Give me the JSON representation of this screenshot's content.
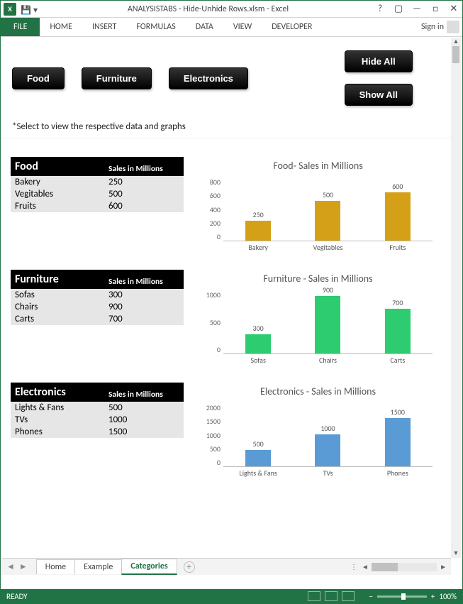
{
  "titlebar": {
    "app_short": "X",
    "title": "ANALYSISTABS - Hide-Unhide Rows.xlsm - Excel"
  },
  "win": {
    "help": "?",
    "ribbonopt": "▢",
    "min": "—",
    "max": "□",
    "close": "✕"
  },
  "ribbon": {
    "file": "FILE",
    "tabs": [
      "HOME",
      "INSERT",
      "FORMULAS",
      "DATA",
      "VIEW",
      "DEVELOPER"
    ],
    "signin": "Sign in"
  },
  "top": {
    "btn_food": "Food",
    "btn_furniture": "Furniture",
    "btn_electronics": "Electronics",
    "btn_hide": "Hide All",
    "btn_show": "Show All",
    "hint": "*Select to view the respective data and graphs"
  },
  "tables": {
    "food": {
      "header1": "Food",
      "header2": "Sales in Millions",
      "rows": [
        [
          "Bakery",
          "250"
        ],
        [
          "Vegitables",
          "500"
        ],
        [
          "Fruits",
          "600"
        ]
      ]
    },
    "furniture": {
      "header1": "Furniture",
      "header2": "Sales in Millions",
      "rows": [
        [
          "Sofas",
          "300"
        ],
        [
          "Chairs",
          "900"
        ],
        [
          "Carts",
          "700"
        ]
      ]
    },
    "electronics": {
      "header1": "Electronics",
      "header2": "Sales in Millions",
      "rows": [
        [
          "Lights & Fans",
          "500"
        ],
        [
          "TVs",
          "1000"
        ],
        [
          "Phones",
          "1500"
        ]
      ]
    }
  },
  "chart_data": [
    {
      "type": "bar",
      "title": "Food- Sales in Millions",
      "categories": [
        "Bakery",
        "Vegitables",
        "Fruits"
      ],
      "values": [
        250,
        500,
        600
      ],
      "ylim": [
        0,
        800
      ],
      "yticks": [
        "800",
        "600",
        "400",
        "200",
        "0"
      ],
      "color": "#d4a017"
    },
    {
      "type": "bar",
      "title": "Furniture - Sales in Millions",
      "categories": [
        "Sofas",
        "Chairs",
        "Carts"
      ],
      "values": [
        300,
        900,
        700
      ],
      "ylim": [
        0,
        1000
      ],
      "yticks": [
        "1000",
        "500",
        "0"
      ],
      "color": "#2ecc71"
    },
    {
      "type": "bar",
      "title": "Electronics - Sales in Millions",
      "categories": [
        "Lights & Fans",
        "TVs",
        "Phones"
      ],
      "values": [
        500,
        1000,
        1500
      ],
      "ylim": [
        0,
        2000
      ],
      "yticks": [
        "2000",
        "1500",
        "1000",
        "500",
        "0"
      ],
      "color": "#5b9bd5"
    }
  ],
  "sheettabs": {
    "tabs": [
      "Home",
      "Example",
      "Categories"
    ],
    "active": 2,
    "add": "+"
  },
  "status": {
    "ready": "READY",
    "zoom": "100%"
  }
}
